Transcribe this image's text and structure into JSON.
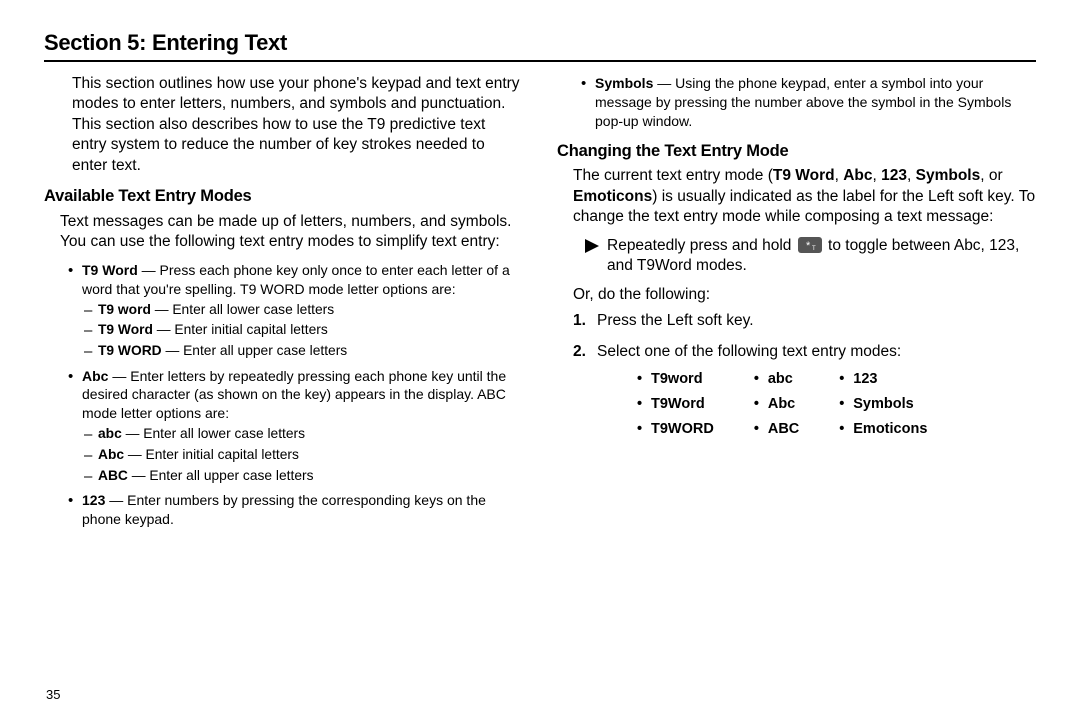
{
  "section_title": "Section 5: Entering Text",
  "page_number": "35",
  "left": {
    "intro": "This section outlines how use your phone's keypad and text entry modes to enter letters, numbers, and symbols and punctuation. This section also describes how to use the T9 predictive text entry system to reduce the number of key strokes needed to enter text.",
    "subhead1": "Available Text Entry Modes",
    "p1": "Text messages can be made up of letters, numbers, and symbols. You can use the following text entry modes to simplify text entry:",
    "t9_label": "T9 Word",
    "t9_text": " — Press each phone key only once to enter each letter of a word that you're spelling. T9 WORD mode letter options are:",
    "t9_sub": [
      {
        "b": "T9 word",
        "t": " — Enter all lower case letters"
      },
      {
        "b": "T9 Word",
        "t": " — Enter initial capital letters"
      },
      {
        "b": "T9 WORD",
        "t": " — Enter all upper case letters"
      }
    ],
    "abc_label": "Abc",
    "abc_text": " — Enter letters by repeatedly pressing each phone key until the desired character (as shown on the key) appears in the display. ABC mode letter options are:",
    "abc_sub": [
      {
        "b": "abc",
        "t": " — Enter all lower case letters"
      },
      {
        "b": "Abc",
        "t": " — Enter initial capital letters"
      },
      {
        "b": "ABC",
        "t": " — Enter all upper case letters"
      }
    ],
    "num_label": "123",
    "num_text": " — Enter numbers by pressing the corresponding keys on the phone keypad."
  },
  "right": {
    "sym_label": "Symbols",
    "sym_text": " — Using the phone keypad, enter a symbol into your message by pressing the number above the symbol in the Symbols pop-up window.",
    "subhead2": "Changing the Text Entry Mode",
    "p2a": "The current text entry mode (",
    "p2b_items": [
      "T9 Word",
      "Abc",
      "123",
      "Symbols"
    ],
    "p2c": ", or ",
    "p2d": "Emoticons",
    "p2e": ") is usually indicated as the label for the Left soft key. To change the text entry mode while composing a text message:",
    "arrow_text_a": "Repeatedly press and hold ",
    "arrow_text_b": " to toggle between Abc, 123, and T9Word modes.",
    "or_text": "Or, do the following:",
    "step1": "Press the Left soft key.",
    "step2": "Select one of the following text entry modes:",
    "modes_col1": [
      "T9word",
      "T9Word",
      "T9WORD"
    ],
    "modes_col2": [
      "abc",
      "Abc",
      "ABC"
    ],
    "modes_col3": [
      "123",
      "Symbols",
      "Emoticons"
    ]
  }
}
